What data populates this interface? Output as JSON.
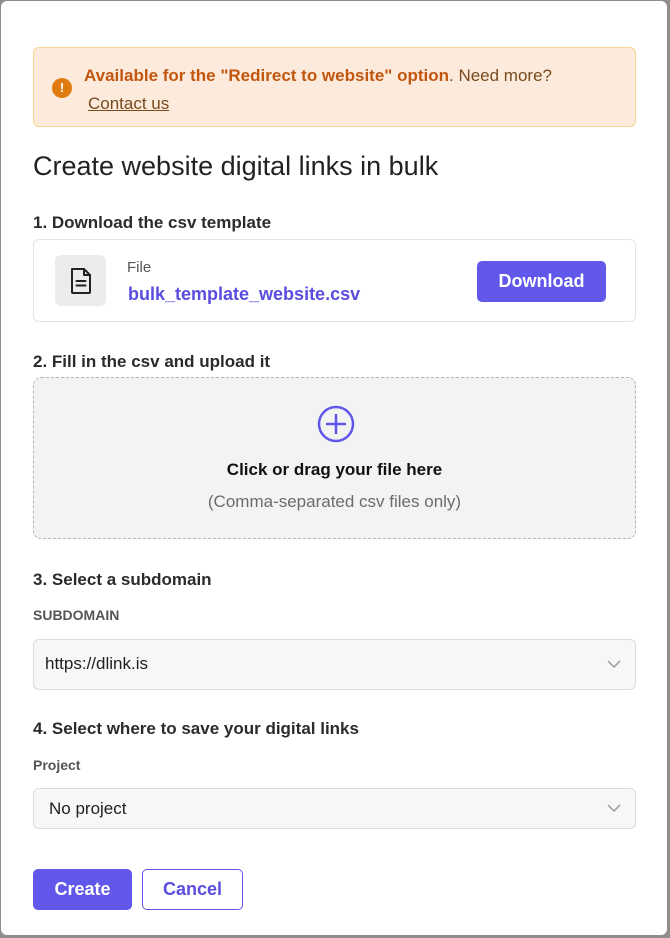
{
  "banner": {
    "strong_text": "Available for the \"Redirect to website\" option",
    "rest_text": ". Need more?",
    "link_label": "Contact us",
    "icon": "exclamation-icon",
    "accent_color": "#e07b12"
  },
  "title": "Create website digital links in bulk",
  "step1": {
    "heading": "1. Download the csv template",
    "file_label": "File",
    "file_name": "bulk_template_website.csv",
    "download_label": "Download",
    "icon": "document-icon"
  },
  "step2": {
    "heading": "2. Fill in the csv and upload it",
    "dropzone_title": "Click or drag your file here",
    "dropzone_subtitle": "(Comma-separated csv files only)",
    "icon": "plus-circle-icon"
  },
  "step3": {
    "heading": "3. Select a subdomain",
    "field_label": "SUBDOMAIN",
    "selected_value": "https://dlink.is"
  },
  "step4": {
    "heading": "4. Select where to save your digital links",
    "field_label": "Project",
    "selected_value": "No project"
  },
  "actions": {
    "create_label": "Create",
    "cancel_label": "Cancel"
  },
  "colors": {
    "primary": "#6157ea",
    "banner_bg": "#fcebdc",
    "banner_border": "#f6d68e"
  }
}
